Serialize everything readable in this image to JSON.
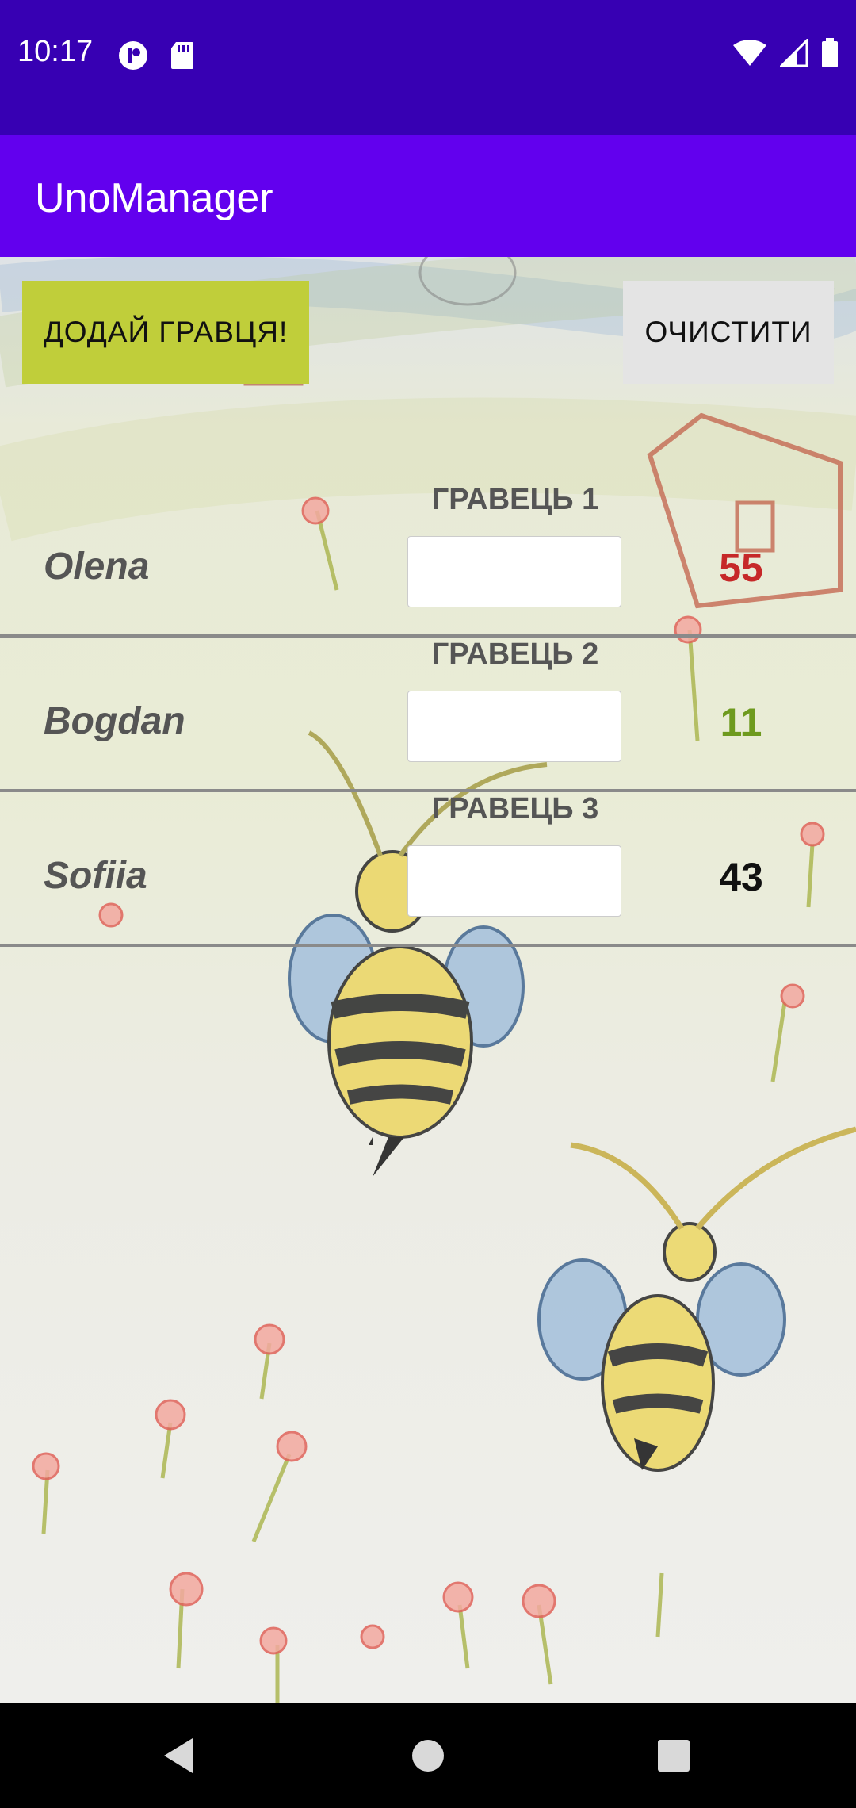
{
  "status_bar": {
    "time": "10:17",
    "left_icons": [
      "notification-app-icon",
      "sd-card-icon"
    ],
    "right_icons": [
      "wifi-icon",
      "cell-signal-icon",
      "battery-icon"
    ]
  },
  "app_bar": {
    "title": "UnoManager"
  },
  "toolbar": {
    "add_player_label": "ДОДАЙ ГРАВЦЯ!",
    "clear_label": "ОЧИСТИТИ",
    "add_player_color": "#c0ce3a",
    "clear_color": "#e4e4e4"
  },
  "players": [
    {
      "header": "ГРАВЕЦЬ 1",
      "name": "Olena",
      "input_value": "",
      "score": "55",
      "score_color": "#c62828"
    },
    {
      "header": "ГРАВЕЦЬ 2",
      "name": "Bogdan",
      "input_value": "",
      "score": "11",
      "score_color": "#6e9a1e"
    },
    {
      "header": "ГРАВЕЦЬ 3",
      "name": "Sofiia",
      "input_value": "",
      "score": "43",
      "score_color": "#111111"
    }
  ],
  "nav_bar": {
    "back": "back-icon",
    "home": "home-icon",
    "recents": "recents-icon"
  },
  "colors": {
    "status_bar": "#3700b3",
    "app_bar": "#6200ee"
  }
}
